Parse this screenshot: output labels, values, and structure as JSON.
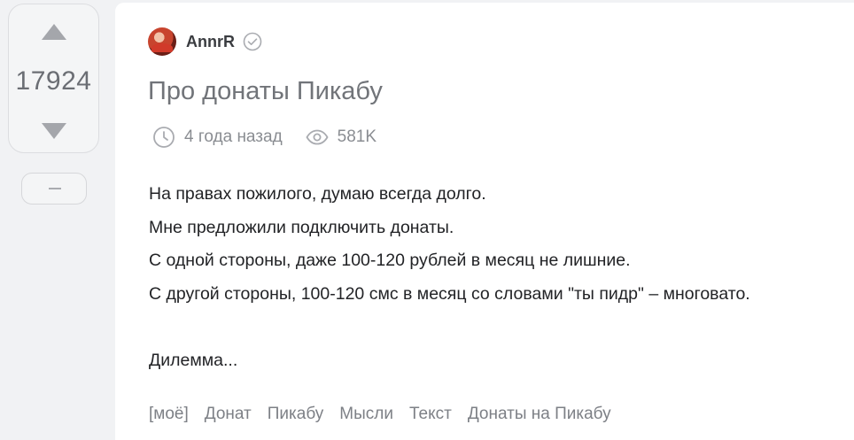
{
  "vote": {
    "count": "17924"
  },
  "post": {
    "author": "AnnrR",
    "title": "Про донаты Пикабу",
    "time": "4 года назад",
    "views": "581K",
    "body": [
      "На правах пожилого, думаю всегда долго.",
      "Мне предложили подключить донаты.",
      "С одной стороны, даже 100-120 рублей в месяц не лишние.",
      "С другой стороны, 100-120 смс в месяц со словами \"ты пидр\" – многовато.",
      "",
      "Дилемма..."
    ],
    "tags": [
      "[моё]",
      "Донат",
      "Пикабу",
      "Мысли",
      "Текст",
      "Донаты на Пикабу"
    ]
  },
  "icons": {
    "vote_up": "triangle-up-icon",
    "vote_down": "triangle-down-icon",
    "verified": "check-circle-icon",
    "clock": "clock-icon",
    "eye": "eye-icon"
  },
  "colors": {
    "background": "#f1f2f4",
    "card": "#ffffff",
    "title": "#717479",
    "text": "#222326",
    "muted": "#8a8d92"
  }
}
